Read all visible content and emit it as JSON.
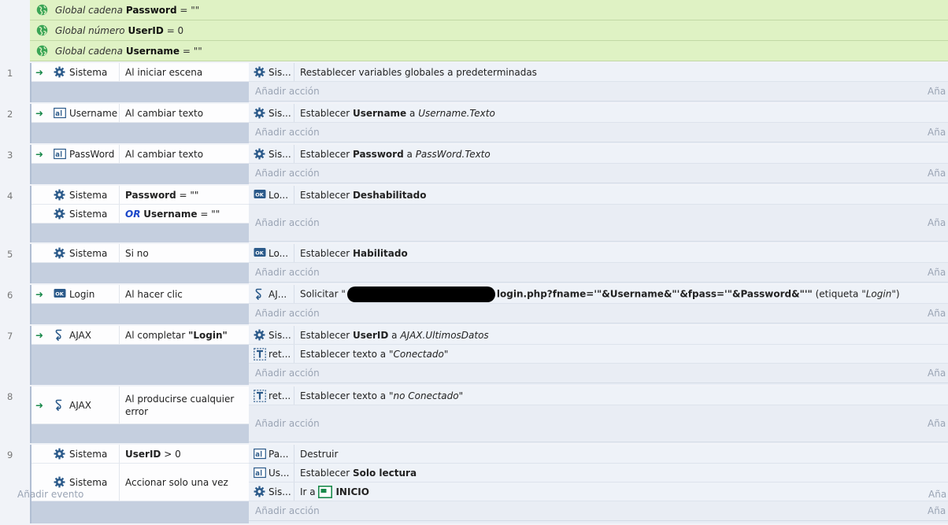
{
  "globals": [
    {
      "prefix": "Global cadena",
      "name": "Password",
      "value": "= \"\""
    },
    {
      "prefix": "Global número",
      "name": "UserID",
      "value": "= 0"
    },
    {
      "prefix": "Global cadena",
      "name": "Username",
      "value": "= \"\""
    }
  ],
  "add_action_label": "Añadir acción",
  "add_action_right": "Aña",
  "add_event_label": "Añadir evento",
  "add_event_right": "Aña",
  "events": [
    {
      "num": "1",
      "conditions": [
        {
          "object": "Sistema",
          "icon": "gear-icon",
          "text": "Al iniciar escena"
        }
      ],
      "actions": [
        {
          "object": "Sis...",
          "icon": "gear-icon",
          "text": "Restablecer variables globales a predeterminadas"
        }
      ]
    },
    {
      "num": "2",
      "conditions": [
        {
          "object": "Username",
          "icon": "textbox-icon",
          "text": "Al cambiar texto"
        }
      ],
      "actions": [
        {
          "object": "Sis...",
          "icon": "gear-icon",
          "pre": "Establecer",
          "bold": "Username",
          "mid": "a",
          "italic": "Username.Texto"
        }
      ]
    },
    {
      "num": "3",
      "conditions": [
        {
          "object": "PassWord",
          "icon": "textbox-icon",
          "text": "Al cambiar texto"
        }
      ],
      "actions": [
        {
          "object": "Sis...",
          "icon": "gear-icon",
          "pre": "Establecer",
          "bold": "Password",
          "mid": "a",
          "italic": "PassWord.Texto"
        }
      ]
    },
    {
      "num": "4",
      "conditions": [
        {
          "object": "Sistema",
          "icon": "gear-icon",
          "bold": "Password",
          "rest": "= \"\""
        },
        {
          "object": "Sistema",
          "icon": "gear-icon",
          "or": "OR",
          "bold": "Username",
          "rest": "= \"\""
        }
      ],
      "actions": [
        {
          "object": "Lo...",
          "icon": "button-icon",
          "pre": "Establecer",
          "bold": "Deshabilitado"
        }
      ]
    },
    {
      "num": "5",
      "conditions": [
        {
          "object": "Sistema",
          "icon": "gear-icon",
          "text": "Si no"
        }
      ],
      "actions": [
        {
          "object": "Lo...",
          "icon": "button-icon",
          "pre": "Establecer",
          "bold": "Habilitado"
        }
      ]
    },
    {
      "num": "6",
      "conditions": [
        {
          "object": "Login",
          "icon": "button-icon",
          "text": "Al hacer clic"
        }
      ],
      "actions": [
        {
          "object": "AJ...",
          "icon": "ajax-icon",
          "pre": "Solicitar",
          "q1": "\"",
          "bold": "login.php?fname='\"&Username&\"'&fpass='\"&Password&\"'\"",
          "tail": "(etiqueta",
          "italic": "\"Login\"",
          "close": ")"
        }
      ]
    },
    {
      "num": "7",
      "conditions": [
        {
          "object": "AJAX",
          "icon": "ajax-icon",
          "text": "Al completar",
          "bold_after": "\"Login\""
        }
      ],
      "actions": [
        {
          "object": "Sis...",
          "icon": "gear-icon",
          "pre": "Establecer",
          "bold": "UserID",
          "mid": "a",
          "italic": "AJAX.UltimosDatos"
        },
        {
          "object": "ret...",
          "icon": "text-icon",
          "pre": "Establecer texto a",
          "italic": "\"Conectado\""
        }
      ]
    },
    {
      "num": "8",
      "conditions": [
        {
          "object": "AJAX",
          "icon": "ajax-icon",
          "text": "Al producirse cualquier error"
        }
      ],
      "actions": [
        {
          "object": "ret...",
          "icon": "text-icon",
          "pre": "Establecer texto a",
          "italic": "\"no Conectado\""
        }
      ]
    },
    {
      "num": "9",
      "conditions": [
        {
          "object": "Sistema",
          "icon": "gear-icon",
          "bold": "UserID",
          "rest": "> 0"
        },
        {
          "object": "Sistema",
          "icon": "gear-icon",
          "text": "Accionar solo una vez"
        }
      ],
      "actions": [
        {
          "object": "Pa...",
          "icon": "textbox-icon",
          "text": "Destruir"
        },
        {
          "object": "Us...",
          "icon": "textbox-icon",
          "pre": "Establecer",
          "bold": "Solo lectura"
        },
        {
          "object": "Sis...",
          "icon": "gear-icon",
          "pre": "Ir a",
          "bold": "INICIO"
        }
      ]
    }
  ],
  "colors": {
    "global_bg": "#dff2c4",
    "trigger_arrow": "#1b8a4c",
    "or_keyword": "#1a46c9"
  }
}
